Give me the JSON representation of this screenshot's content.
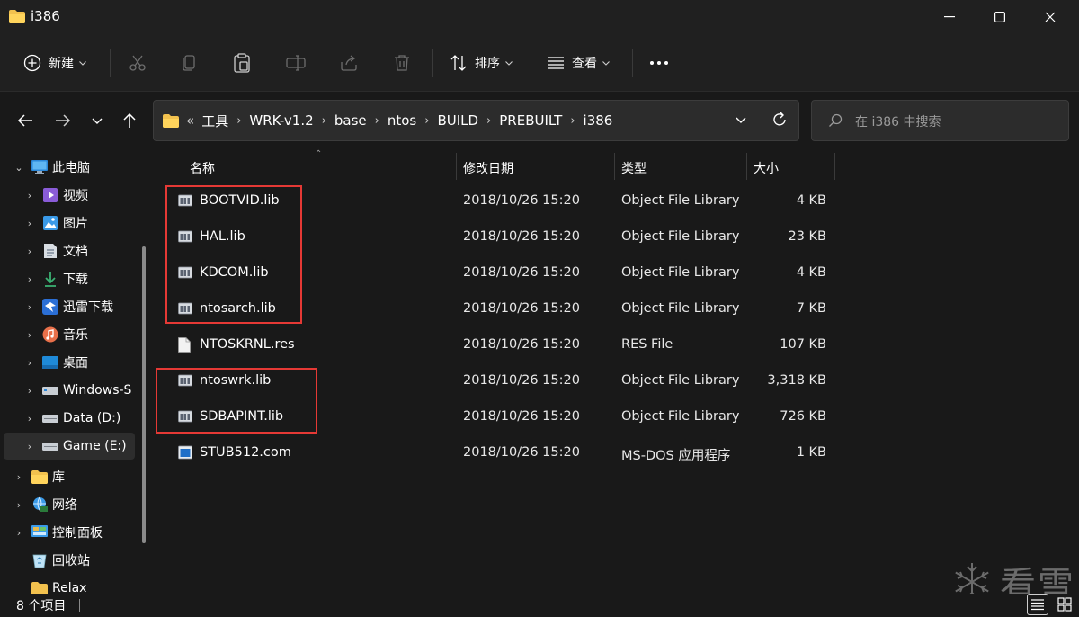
{
  "window": {
    "title": "i386"
  },
  "toolbar": {
    "new_label": "新建",
    "sort_label": "排序",
    "view_label": "查看"
  },
  "address": {
    "overflow": "«",
    "crumbs": [
      "工具",
      "WRK-v1.2",
      "base",
      "ntos",
      "BUILD",
      "PREBUILT",
      "i386"
    ]
  },
  "search": {
    "placeholder": "在 i386 中搜索"
  },
  "sidebar": {
    "items": [
      {
        "label": "此电脑",
        "icon": "computer-icon",
        "expanded": true
      },
      {
        "label": "视频",
        "icon": "video-folder-icon"
      },
      {
        "label": "图片",
        "icon": "pictures-folder-icon"
      },
      {
        "label": "文档",
        "icon": "documents-folder-icon"
      },
      {
        "label": "下载",
        "icon": "download-icon"
      },
      {
        "label": "迅雷下载",
        "icon": "thunder-icon"
      },
      {
        "label": "音乐",
        "icon": "music-icon"
      },
      {
        "label": "桌面",
        "icon": "desktop-icon"
      },
      {
        "label": "Windows-S",
        "icon": "drive-icon"
      },
      {
        "label": "Data (D:)",
        "icon": "drive-icon"
      },
      {
        "label": "Game (E:)",
        "icon": "drive-icon",
        "selected": true
      },
      {
        "label": "库",
        "icon": "library-icon"
      },
      {
        "label": "网络",
        "icon": "network-icon"
      },
      {
        "label": "控制面板",
        "icon": "control-panel-icon"
      },
      {
        "label": "回收站",
        "icon": "recycle-bin-icon"
      },
      {
        "label": "Relax",
        "icon": "folder-icon"
      }
    ]
  },
  "columns": {
    "name": "名称",
    "date": "修改日期",
    "type": "类型",
    "size": "大小"
  },
  "files": [
    {
      "name": "BOOTVID.lib",
      "date": "2018/10/26 15:20",
      "type": "Object File Library",
      "size": "4 KB",
      "icon": "lib-file-icon"
    },
    {
      "name": "HAL.lib",
      "date": "2018/10/26 15:20",
      "type": "Object File Library",
      "size": "23 KB",
      "icon": "lib-file-icon"
    },
    {
      "name": "KDCOM.lib",
      "date": "2018/10/26 15:20",
      "type": "Object File Library",
      "size": "4 KB",
      "icon": "lib-file-icon"
    },
    {
      "name": "ntosarch.lib",
      "date": "2018/10/26 15:20",
      "type": "Object File Library",
      "size": "7 KB",
      "icon": "lib-file-icon"
    },
    {
      "name": "NTOSKRNL.res",
      "date": "2018/10/26 15:20",
      "type": "RES File",
      "size": "107 KB",
      "icon": "blank-file-icon"
    },
    {
      "name": "ntoswrk.lib",
      "date": "2018/10/26 15:20",
      "type": "Object File Library",
      "size": "3,318 KB",
      "icon": "lib-file-icon"
    },
    {
      "name": "SDBAPINT.lib",
      "date": "2018/10/26 15:20",
      "type": "Object File Library",
      "size": "726 KB",
      "icon": "lib-file-icon"
    },
    {
      "name": "STUB512.com",
      "date": "2018/10/26 15:20",
      "type": "MS-DOS 应用程序",
      "size": "1 KB",
      "icon": "dos-app-icon"
    }
  ],
  "status": {
    "count": "8 个项目"
  },
  "watermark": {
    "text": "看雪"
  },
  "colors": {
    "highlight": "#e53935",
    "background": "#191919",
    "chrome": "#202020"
  }
}
